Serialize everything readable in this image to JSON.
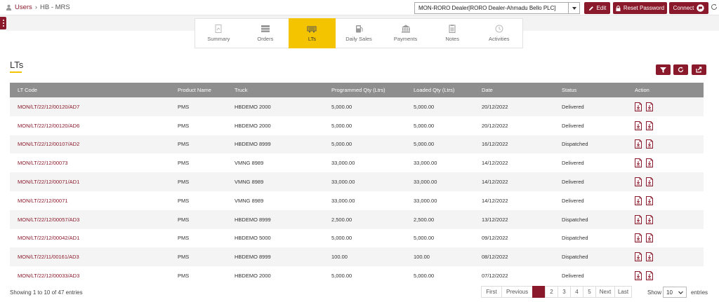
{
  "breadcrumb": {
    "root": "Users",
    "current": "HB - MRS"
  },
  "header": {
    "dealer_selected": "MON-RORO Dealer[RORO Dealer-Ahmadu Bello PLC]",
    "edit_label": "Edit",
    "reset_label": "Reset Password",
    "connect_label": "Connect"
  },
  "tabs": [
    {
      "label": "Summary",
      "icon": "chart-doc-icon"
    },
    {
      "label": "Orders",
      "icon": "orders-icon"
    },
    {
      "label": "LTs",
      "icon": "truck-icon",
      "active": true
    },
    {
      "label": "Daily Sales",
      "icon": "fuel-pump-icon"
    },
    {
      "label": "Payments",
      "icon": "bank-icon"
    },
    {
      "label": "Notes",
      "icon": "clipboard-icon"
    },
    {
      "label": "Activities",
      "icon": "clock-icon"
    }
  ],
  "page": {
    "title": "LTs"
  },
  "table": {
    "columns": [
      "LT Code",
      "Product Name",
      "Truck",
      "Programmed Qty (Ltrs)",
      "Loaded Qty (Ltrs)",
      "Date",
      "Status",
      "Action"
    ],
    "rows": [
      [
        "MON/LT/22/12/00120/AD7",
        "PMS",
        "HBDEMO 2000",
        "5,000.00",
        "5,000.00",
        "20/12/2022",
        "Delivered"
      ],
      [
        "MON/LT/22/12/00120/AD6",
        "PMS",
        "HBDEMO 2000",
        "5,000.00",
        "5,000.00",
        "20/12/2022",
        "Delivered"
      ],
      [
        "MON/LT/22/12/00107/AD2",
        "PMS",
        "HBDEMO 8999",
        "5,000.00",
        "5,000.00",
        "16/12/2022",
        "Dispatched"
      ],
      [
        "MON/LT/22/12/00073",
        "PMS",
        "VMNG 8989",
        "33,000.00",
        "33,000.00",
        "14/12/2022",
        "Delivered"
      ],
      [
        "MON/LT/22/12/00071/AD1",
        "PMS",
        "VMNG 8989",
        "33,000.00",
        "33,000.00",
        "14/12/2022",
        "Delivered"
      ],
      [
        "MON/LT/22/12/00071",
        "PMS",
        "VMNG 8989",
        "33,000.00",
        "33,000.00",
        "14/12/2022",
        "Delivered"
      ],
      [
        "MON/LT/22/12/00057/AD3",
        "PMS",
        "HBDEMO 8999",
        "2,500.00",
        "2,500.00",
        "13/12/2022",
        "Dispatched"
      ],
      [
        "MON/LT/22/12/00042/AD1",
        "PMS",
        "HBDEMO 5000",
        "5,000.00",
        "5,000.00",
        "09/12/2022",
        "Dispatched"
      ],
      [
        "MON/LT/22/11/00161/AD3",
        "PMS",
        "HBDEMO 8999",
        "100.00",
        "100.00",
        "08/12/2022",
        "Dispatched"
      ],
      [
        "MON/LT/22/12/00033/AD3",
        "PMS",
        "HBDEMO 2000",
        "5,000.00",
        "5,000.00",
        "07/12/2022",
        "Delivered"
      ]
    ]
  },
  "footer": {
    "showing": "Showing 1 to 10 of 47 entries",
    "pagination": [
      "First",
      "Previous",
      "1",
      "2",
      "3",
      "4",
      "5",
      "Next",
      "Last"
    ],
    "active_page": "1",
    "show_label": "Show",
    "page_size": "10",
    "entries_label": "entries"
  },
  "colors": {
    "brand": "#8a1a2b",
    "accent": "#f5c400",
    "header_bg": "#8e8e8e"
  }
}
